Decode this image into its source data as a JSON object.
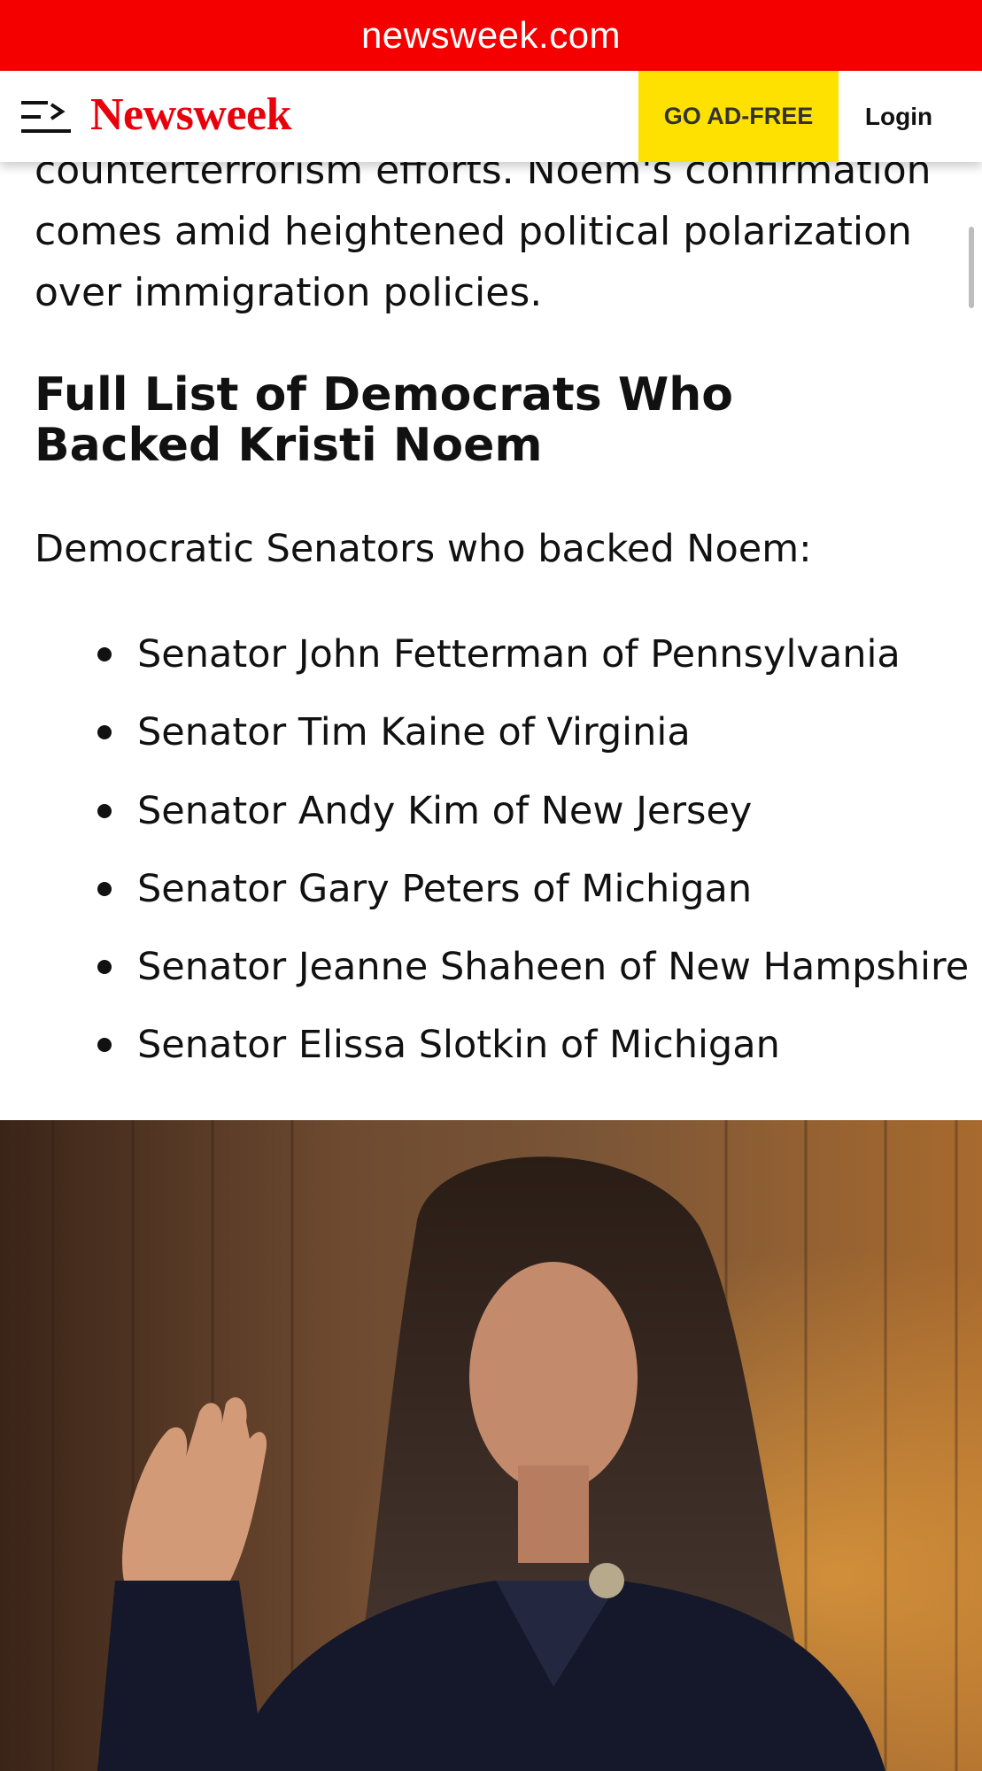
{
  "browser": {
    "url": "newsweek.com"
  },
  "header": {
    "logo": "Newsweek",
    "ad_free_label": "GO AD-FREE",
    "login_label": "Login",
    "menu_icon": "menu-icon"
  },
  "article": {
    "top_paragraph": "counterterrorism efforts. Noem's confirmation comes amid heightened political polarization over immigration policies.",
    "section_heading": "Full List of Democrats Who Backed Kristi Noem",
    "intro": "Democratic Senators who backed Noem:",
    "senators": [
      "Senator John Fetterman of Pennsylvania",
      "Senator Tim Kaine of Virginia",
      "Senator Andy Kim of New Jersey",
      "Senator Gary Peters of Michigan",
      "Senator Jeanne Shaheen of New Hampshire",
      "Senator Elissa Slotkin of Michigan"
    ]
  },
  "colors": {
    "url_bar": "#f40000",
    "brand_red": "#e8000b",
    "ad_free_bg": "#ffe100"
  }
}
